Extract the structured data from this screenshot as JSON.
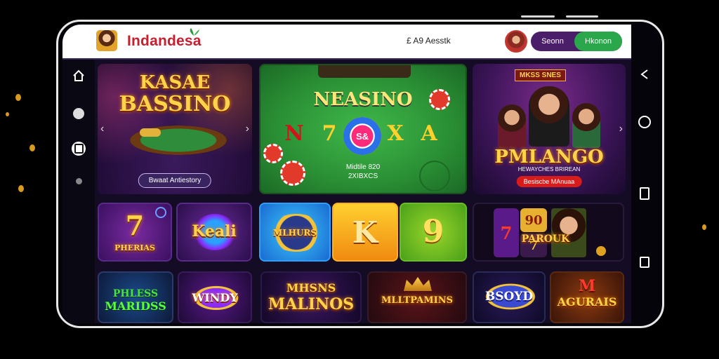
{
  "app": {
    "brand_name": "Indandesa",
    "header_text": "£ A9 Aesstk",
    "button_primary": "Seonn",
    "button_secondary": "Hkonon",
    "colors": {
      "accent": "#2aa74a",
      "brand": "#c52030",
      "button_bg": "#4b1e6a"
    }
  },
  "sidebar": {
    "items": [
      {
        "icon": "home-icon"
      },
      {
        "icon": "circle-icon"
      },
      {
        "icon": "wallet-icon"
      },
      {
        "icon": "dot-icon"
      }
    ]
  },
  "featured": [
    {
      "title_line1": "KASAE",
      "title_line2": "BASSINO",
      "button_label": "Bwaat Antiestory"
    },
    {
      "title": "NEASINO",
      "reel": [
        "N",
        "7",
        "X",
        "A"
      ],
      "chip_text": "S&",
      "subtitle_line1": "Midtile 820",
      "subtitle_line2": "2XIBXCS"
    },
    {
      "banner": "MKSS SNES",
      "title": "PMLANGO",
      "subtitle": "HEWAYCHES BRIREAN",
      "button_label": "Besiscbe MAnuaa"
    }
  ],
  "row2": [
    {
      "title": "7",
      "subtitle": "PHERIAS"
    },
    {
      "title": "Keali"
    },
    {
      "title": "MLHURS"
    },
    {
      "title": "K"
    },
    {
      "title": "9"
    },
    {
      "reels": [
        "7",
        "90",
        "7"
      ],
      "title": "PAROUK"
    }
  ],
  "row3": [
    {
      "title_line1": "PHLESS",
      "title_line2": "MARIDSS"
    },
    {
      "title": "WINDY"
    },
    {
      "title_line1": "MHSNS",
      "title_line2": "MALINOS"
    },
    {
      "title": "MLLTPAMINS"
    },
    {
      "title": "BSOYD"
    },
    {
      "title_line1": "M",
      "title_line2": "AGURAIS"
    }
  ],
  "phone_buttons": [
    {
      "icon": "back-icon"
    },
    {
      "icon": "home-circle-icon"
    },
    {
      "icon": "recents-icon"
    },
    {
      "icon": "square-icon"
    }
  ]
}
